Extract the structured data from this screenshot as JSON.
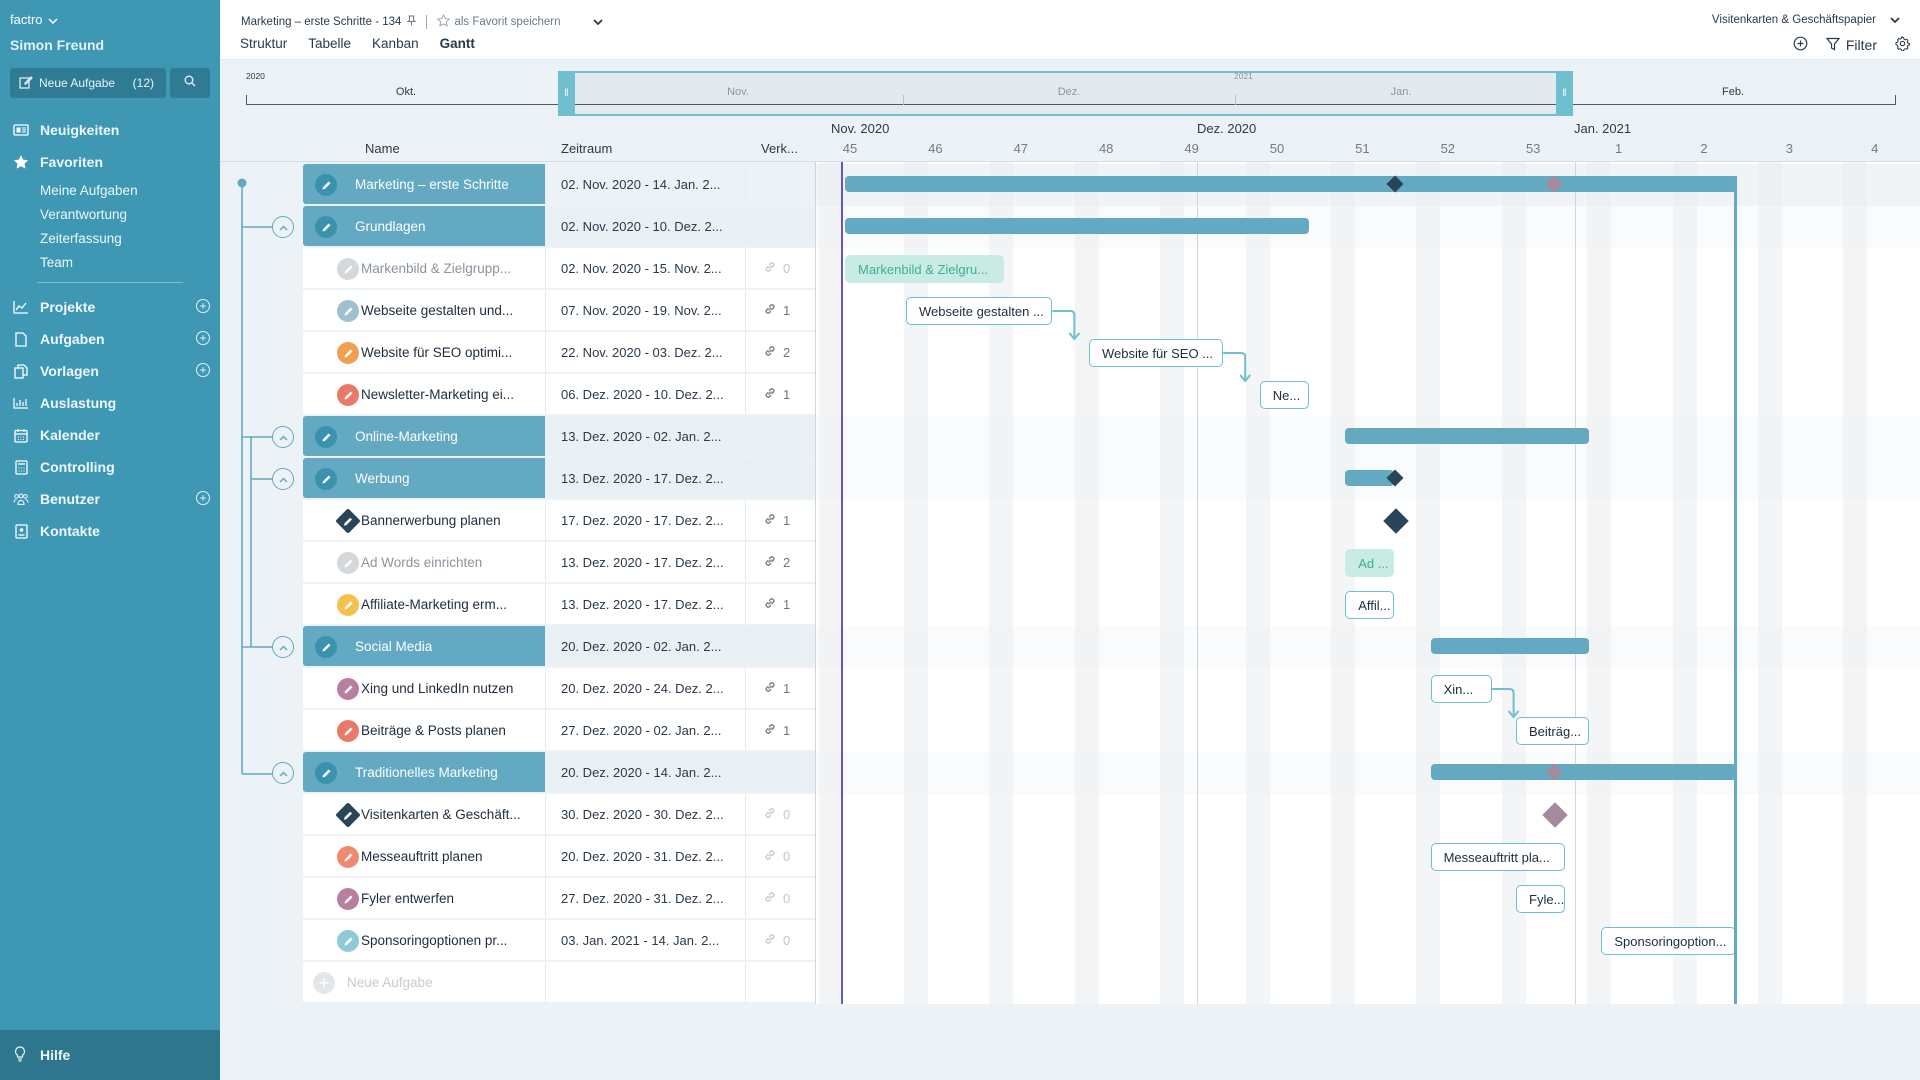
{
  "sidebar": {
    "app_name": "factro",
    "user_name": "Simon Freund",
    "new_task_label": "Neue Aufgabe",
    "new_task_count": "(12)",
    "items": [
      {
        "label": "Neuigkeiten",
        "icon": "newspaper-icon"
      },
      {
        "label": "Favoriten",
        "icon": "star-icon"
      }
    ],
    "favorites": [
      "Meine Aufgaben",
      "Verantwortung",
      "Zeiterfassung",
      "Team"
    ],
    "main_items": [
      {
        "label": "Projekte",
        "icon": "chart-line-icon",
        "has_add": true
      },
      {
        "label": "Aufgaben",
        "icon": "document-icon",
        "has_add": true
      },
      {
        "label": "Vorlagen",
        "icon": "copy-icon",
        "has_add": true
      },
      {
        "label": "Auslastung",
        "icon": "bar-chart-icon",
        "has_add": false
      },
      {
        "label": "Kalender",
        "icon": "calendar-icon",
        "has_add": false
      },
      {
        "label": "Controlling",
        "icon": "calculator-icon",
        "has_add": false
      },
      {
        "label": "Benutzer",
        "icon": "users-icon",
        "has_add": true
      },
      {
        "label": "Kontakte",
        "icon": "contact-card-icon",
        "has_add": false
      }
    ],
    "help_label": "Hilfe"
  },
  "header": {
    "breadcrumb": "Marketing – erste Schritte - 134",
    "favorite_label": "als Favorit speichern",
    "tabs": [
      "Struktur",
      "Tabelle",
      "Kanban",
      "Gantt"
    ],
    "active_tab": "Gantt",
    "selected_project": "Visitenkarten & Geschäftspapier",
    "filter_label": "Filter"
  },
  "overview": {
    "years": [
      "2020",
      "2021"
    ],
    "months": [
      "Okt.",
      "Nov.",
      "Dez.",
      "Jan.",
      "Feb."
    ]
  },
  "columns": {
    "name": "Name",
    "period": "Zeitraum",
    "links": "Verk..."
  },
  "timeline": {
    "months": [
      "Nov. 2020",
      "Dez. 2020",
      "Jan. 2021"
    ],
    "weeks": [
      "45",
      "46",
      "47",
      "48",
      "49",
      "50",
      "51",
      "52",
      "53",
      "1",
      "2",
      "3",
      "4"
    ]
  },
  "rows": [
    {
      "type": "project",
      "name": "Marketing – erste Schritte",
      "period": "02. Nov. 2020 - 14. Jan. 2...",
      "links": "",
      "start": 0,
      "end": 73
    },
    {
      "type": "group",
      "name": "Grundlagen",
      "period": "02. Nov. 2020 - 10. Dez. 2...",
      "links": "",
      "start": 0,
      "end": 38
    },
    {
      "type": "task",
      "name": "Markenbild & Zielgrupp...",
      "gantt_label": "Markenbild & Zielgru...",
      "period": "02. Nov. 2020 - 15. Nov. 2...",
      "links": "0",
      "color": "#d4d8db",
      "status": "done",
      "start": 0,
      "end": 13
    },
    {
      "type": "task",
      "name": "Webseite gestalten und...",
      "gantt_label": "Webseite gestalten ...",
      "period": "07. Nov. 2020 - 19. Nov. 2...",
      "links": "1",
      "color": "#9ec1cf",
      "status": "open",
      "start": 5,
      "end": 17
    },
    {
      "type": "task",
      "name": "Website für SEO optimi...",
      "gantt_label": "Website für SEO ...",
      "period": "22. Nov. 2020 - 03. Dez. 2...",
      "links": "2",
      "color": "#f0a050",
      "status": "open",
      "start": 20,
      "end": 31
    },
    {
      "type": "task",
      "name": "Newsletter-Marketing ei...",
      "gantt_label": "Ne...",
      "period": "06. Dez. 2020 - 10. Dez. 2...",
      "links": "1",
      "color": "#e87a6a",
      "status": "open",
      "start": 34,
      "end": 38
    },
    {
      "type": "group",
      "name": "Online-Marketing",
      "period": "13. Dez. 2020 - 02. Jan. 2...",
      "links": "",
      "start": 41,
      "end": 61
    },
    {
      "type": "group",
      "name": "Werbung",
      "period": "13. Dez. 2020 - 17. Dez. 2...",
      "links": "",
      "start": 41,
      "end": 45
    },
    {
      "type": "milestone",
      "name": "Bannerwerbung planen",
      "period": "17. Dez. 2020 - 17. Dez. 2...",
      "links": "1",
      "color": "#2b4558",
      "start": 45
    },
    {
      "type": "task",
      "name": "Ad Words einrichten",
      "gantt_label": "Ad ...",
      "period": "13. Dez. 2020 - 17. Dez. 2...",
      "links": "2",
      "color": "#d4d8db",
      "status": "done",
      "start": 41,
      "end": 45
    },
    {
      "type": "task",
      "name": "Affiliate-Marketing erm...",
      "gantt_label": "Affil...",
      "period": "13. Dez. 2020 - 17. Dez. 2...",
      "links": "1",
      "color": "#f5c14e",
      "status": "open",
      "start": 41,
      "end": 45
    },
    {
      "type": "group",
      "name": "Social Media",
      "period": "20. Dez. 2020 - 02. Jan. 2...",
      "links": "",
      "start": 48,
      "end": 61
    },
    {
      "type": "task",
      "name": "Xing und LinkedIn nutzen",
      "gantt_label": "Xin...",
      "period": "20. Dez. 2020 - 24. Dez. 2...",
      "links": "1",
      "color": "#b97fa0",
      "status": "open",
      "start": 48,
      "end": 53
    },
    {
      "type": "task",
      "name": "Beiträge & Posts planen",
      "gantt_label": "Beiträg...",
      "period": "27. Dez. 2020 - 02. Jan. 2...",
      "links": "1",
      "color": "#e87a6a",
      "status": "open",
      "start": 55,
      "end": 61
    },
    {
      "type": "group",
      "name": "Traditionelles Marketing",
      "period": "20. Dez. 2020 - 14. Jan. 2...",
      "links": "",
      "start": 48,
      "end": 73
    },
    {
      "type": "milestone",
      "name": "Visitenkarten & Geschäft...",
      "period": "30. Dez. 2020 - 30. Dez. 2...",
      "links": "0",
      "color": "#2b4558",
      "gantt_color": "#a5899c",
      "start": 58
    },
    {
      "type": "task",
      "name": "Messeauftritt planen",
      "gantt_label": "Messeauftritt pla...",
      "period": "20. Dez. 2020 - 31. Dez. 2...",
      "links": "0",
      "color": "#ef8a70",
      "status": "open",
      "start": 48,
      "end": 59
    },
    {
      "type": "task",
      "name": "Fyler entwerfen",
      "gantt_label": "Fyle...",
      "period": "27. Dez. 2020 - 31. Dez. 2...",
      "links": "0",
      "color": "#b97fa0",
      "status": "open",
      "start": 55,
      "end": 59
    },
    {
      "type": "task",
      "name": "Sponsoringoptionen pr...",
      "gantt_label": "Sponsoringoption...",
      "period": "03. Jan. 2021 - 14. Jan. 2...",
      "links": "0",
      "color": "#8ec9d6",
      "status": "open",
      "start": 62,
      "end": 73
    }
  ],
  "new_task_placeholder": "Neue Aufgabe",
  "colors": {
    "sidebar": "#3e97b3",
    "accent": "#62a9c1",
    "today_line": "#6a52c8",
    "done_bar": "#c8ebe4"
  }
}
